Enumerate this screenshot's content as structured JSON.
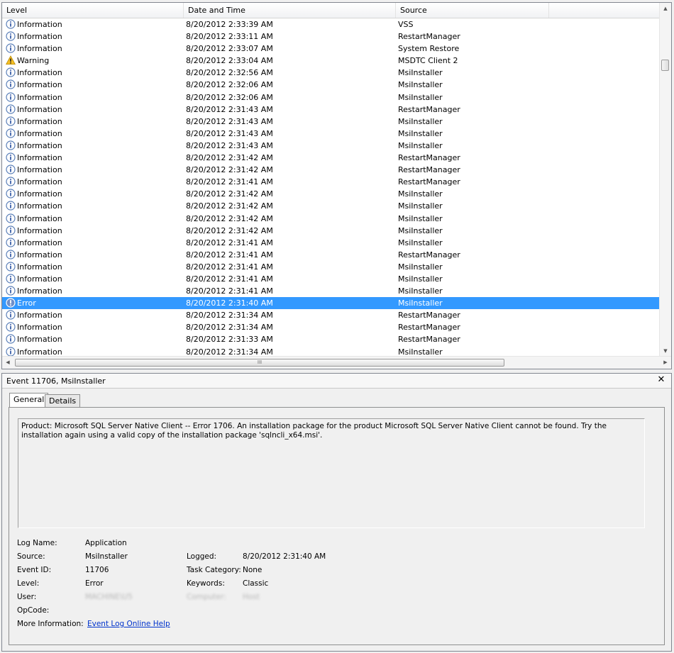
{
  "columns": {
    "level": "Level",
    "date": "Date and Time",
    "source": "Source"
  },
  "events": [
    {
      "level": "Information",
      "icon": "info",
      "date": "8/20/2012 2:33:39 AM",
      "source": "VSS"
    },
    {
      "level": "Information",
      "icon": "info",
      "date": "8/20/2012 2:33:11 AM",
      "source": "RestartManager"
    },
    {
      "level": "Information",
      "icon": "info",
      "date": "8/20/2012 2:33:07 AM",
      "source": "System Restore"
    },
    {
      "level": "Warning",
      "icon": "warning",
      "date": "8/20/2012 2:33:04 AM",
      "source": "MSDTC Client 2"
    },
    {
      "level": "Information",
      "icon": "info",
      "date": "8/20/2012 2:32:56 AM",
      "source": "MsiInstaller"
    },
    {
      "level": "Information",
      "icon": "info",
      "date": "8/20/2012 2:32:06 AM",
      "source": "MsiInstaller"
    },
    {
      "level": "Information",
      "icon": "info",
      "date": "8/20/2012 2:32:06 AM",
      "source": "MsiInstaller"
    },
    {
      "level": "Information",
      "icon": "info",
      "date": "8/20/2012 2:31:43 AM",
      "source": "RestartManager"
    },
    {
      "level": "Information",
      "icon": "info",
      "date": "8/20/2012 2:31:43 AM",
      "source": "MsiInstaller"
    },
    {
      "level": "Information",
      "icon": "info",
      "date": "8/20/2012 2:31:43 AM",
      "source": "MsiInstaller"
    },
    {
      "level": "Information",
      "icon": "info",
      "date": "8/20/2012 2:31:43 AM",
      "source": "MsiInstaller"
    },
    {
      "level": "Information",
      "icon": "info",
      "date": "8/20/2012 2:31:42 AM",
      "source": "RestartManager"
    },
    {
      "level": "Information",
      "icon": "info",
      "date": "8/20/2012 2:31:42 AM",
      "source": "RestartManager"
    },
    {
      "level": "Information",
      "icon": "info",
      "date": "8/20/2012 2:31:41 AM",
      "source": "RestartManager"
    },
    {
      "level": "Information",
      "icon": "info",
      "date": "8/20/2012 2:31:42 AM",
      "source": "MsiInstaller"
    },
    {
      "level": "Information",
      "icon": "info",
      "date": "8/20/2012 2:31:42 AM",
      "source": "MsiInstaller"
    },
    {
      "level": "Information",
      "icon": "info",
      "date": "8/20/2012 2:31:42 AM",
      "source": "MsiInstaller"
    },
    {
      "level": "Information",
      "icon": "info",
      "date": "8/20/2012 2:31:42 AM",
      "source": "MsiInstaller"
    },
    {
      "level": "Information",
      "icon": "info",
      "date": "8/20/2012 2:31:41 AM",
      "source": "MsiInstaller"
    },
    {
      "level": "Information",
      "icon": "info",
      "date": "8/20/2012 2:31:41 AM",
      "source": "RestartManager"
    },
    {
      "level": "Information",
      "icon": "info",
      "date": "8/20/2012 2:31:41 AM",
      "source": "MsiInstaller"
    },
    {
      "level": "Information",
      "icon": "info",
      "date": "8/20/2012 2:31:41 AM",
      "source": "MsiInstaller"
    },
    {
      "level": "Information",
      "icon": "info",
      "date": "8/20/2012 2:31:41 AM",
      "source": "MsiInstaller"
    },
    {
      "level": "Error",
      "icon": "error",
      "date": "8/20/2012 2:31:40 AM",
      "source": "MsiInstaller",
      "selected": true
    },
    {
      "level": "Information",
      "icon": "info",
      "date": "8/20/2012 2:31:34 AM",
      "source": "RestartManager"
    },
    {
      "level": "Information",
      "icon": "info",
      "date": "8/20/2012 2:31:34 AM",
      "source": "RestartManager"
    },
    {
      "level": "Information",
      "icon": "info",
      "date": "8/20/2012 2:31:33 AM",
      "source": "RestartManager"
    },
    {
      "level": "Information",
      "icon": "info",
      "date": "8/20/2012 2:31:34 AM",
      "source": "MsiInstaller"
    }
  ],
  "scroll": {
    "hthumb_label": "III"
  },
  "detail": {
    "title": "Event 11706, MsiInstaller",
    "close": "✕",
    "tabs": {
      "general": "General",
      "details": "Details"
    },
    "message": "Product: Microsoft SQL Server Native Client -- Error 1706. An installation package for the product Microsoft SQL Server Native Client cannot be found. Try the installation again using a valid copy of the installation package 'sqlncli_x64.msi'.",
    "labels": {
      "log_name": "Log Name:",
      "source": "Source:",
      "event_id": "Event ID:",
      "level": "Level:",
      "user": "User:",
      "opcode": "OpCode:",
      "more_info": "More Information:",
      "logged": "Logged:",
      "task_category": "Task Category:",
      "keywords": "Keywords:"
    },
    "values": {
      "log_name": "Application",
      "source": "MsiInstaller",
      "event_id": "11706",
      "level": "Error",
      "user": "MACHINE\\U5",
      "logged": "8/20/2012 2:31:40 AM",
      "task_category": "None",
      "keywords": "Classic",
      "computer_label": "Computer:",
      "computer_value": "Host",
      "more_info_link": "Event Log Online Help"
    }
  },
  "colors": {
    "selection": "#3399ff",
    "link": "#0033cc",
    "info_icon": "#3a6fc2",
    "warning_icon": "#f6c026",
    "error_icon": "#3a6fc2"
  }
}
